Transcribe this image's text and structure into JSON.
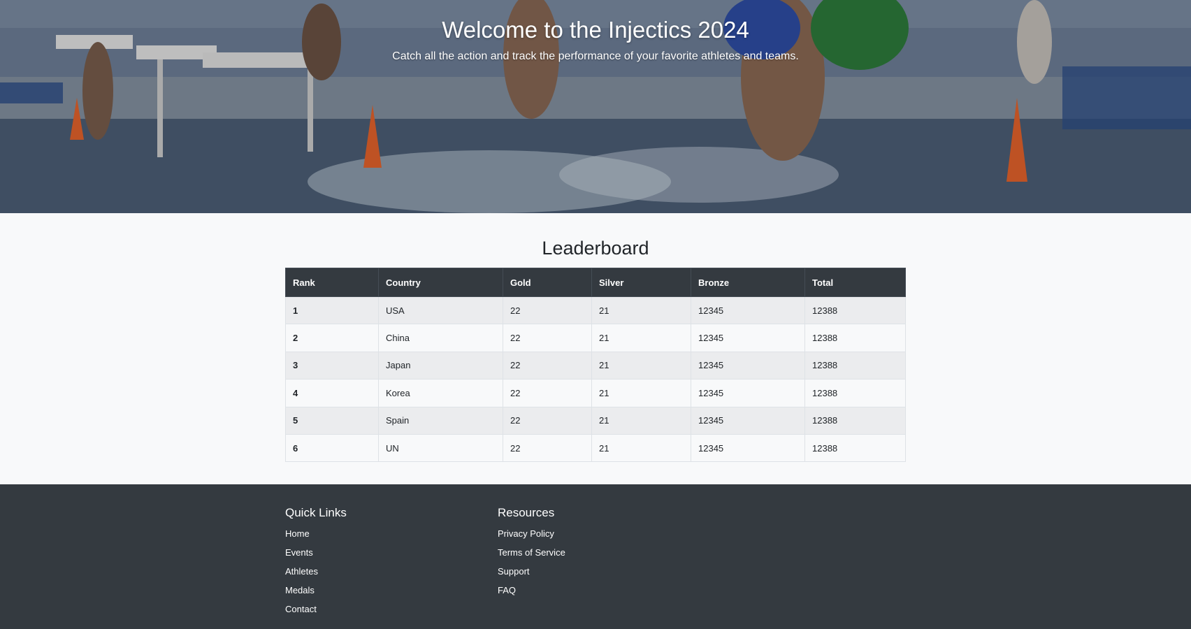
{
  "hero": {
    "title": "Welcome to the Injectics 2024",
    "subtitle": "Catch all the action and track the performance of your favorite athletes and teams."
  },
  "leaderboard": {
    "title": "Leaderboard",
    "columns": [
      "Rank",
      "Country",
      "Gold",
      "Silver",
      "Bronze",
      "Total"
    ],
    "rows": [
      [
        "1",
        "USA",
        "22",
        "21",
        "12345",
        "12388"
      ],
      [
        "2",
        "China",
        "22",
        "21",
        "12345",
        "12388"
      ],
      [
        "3",
        "Japan",
        "22",
        "21",
        "12345",
        "12388"
      ],
      [
        "4",
        "Korea",
        "22",
        "21",
        "12345",
        "12388"
      ],
      [
        "5",
        "Spain",
        "22",
        "21",
        "12345",
        "12388"
      ],
      [
        "6",
        "UN",
        "22",
        "21",
        "12345",
        "12388"
      ]
    ]
  },
  "footer": {
    "quick_links": {
      "title": "Quick Links",
      "items": [
        "Home",
        "Events",
        "Athletes",
        "Medals",
        "Contact"
      ]
    },
    "resources": {
      "title": "Resources",
      "items": [
        "Privacy Policy",
        "Terms of Service",
        "Support",
        "FAQ"
      ]
    }
  },
  "colors": {
    "header_bg": "#343a40",
    "footer_bg": "#343a40",
    "page_bg": "#f8f9fa",
    "hero_text": "#ffffff"
  }
}
